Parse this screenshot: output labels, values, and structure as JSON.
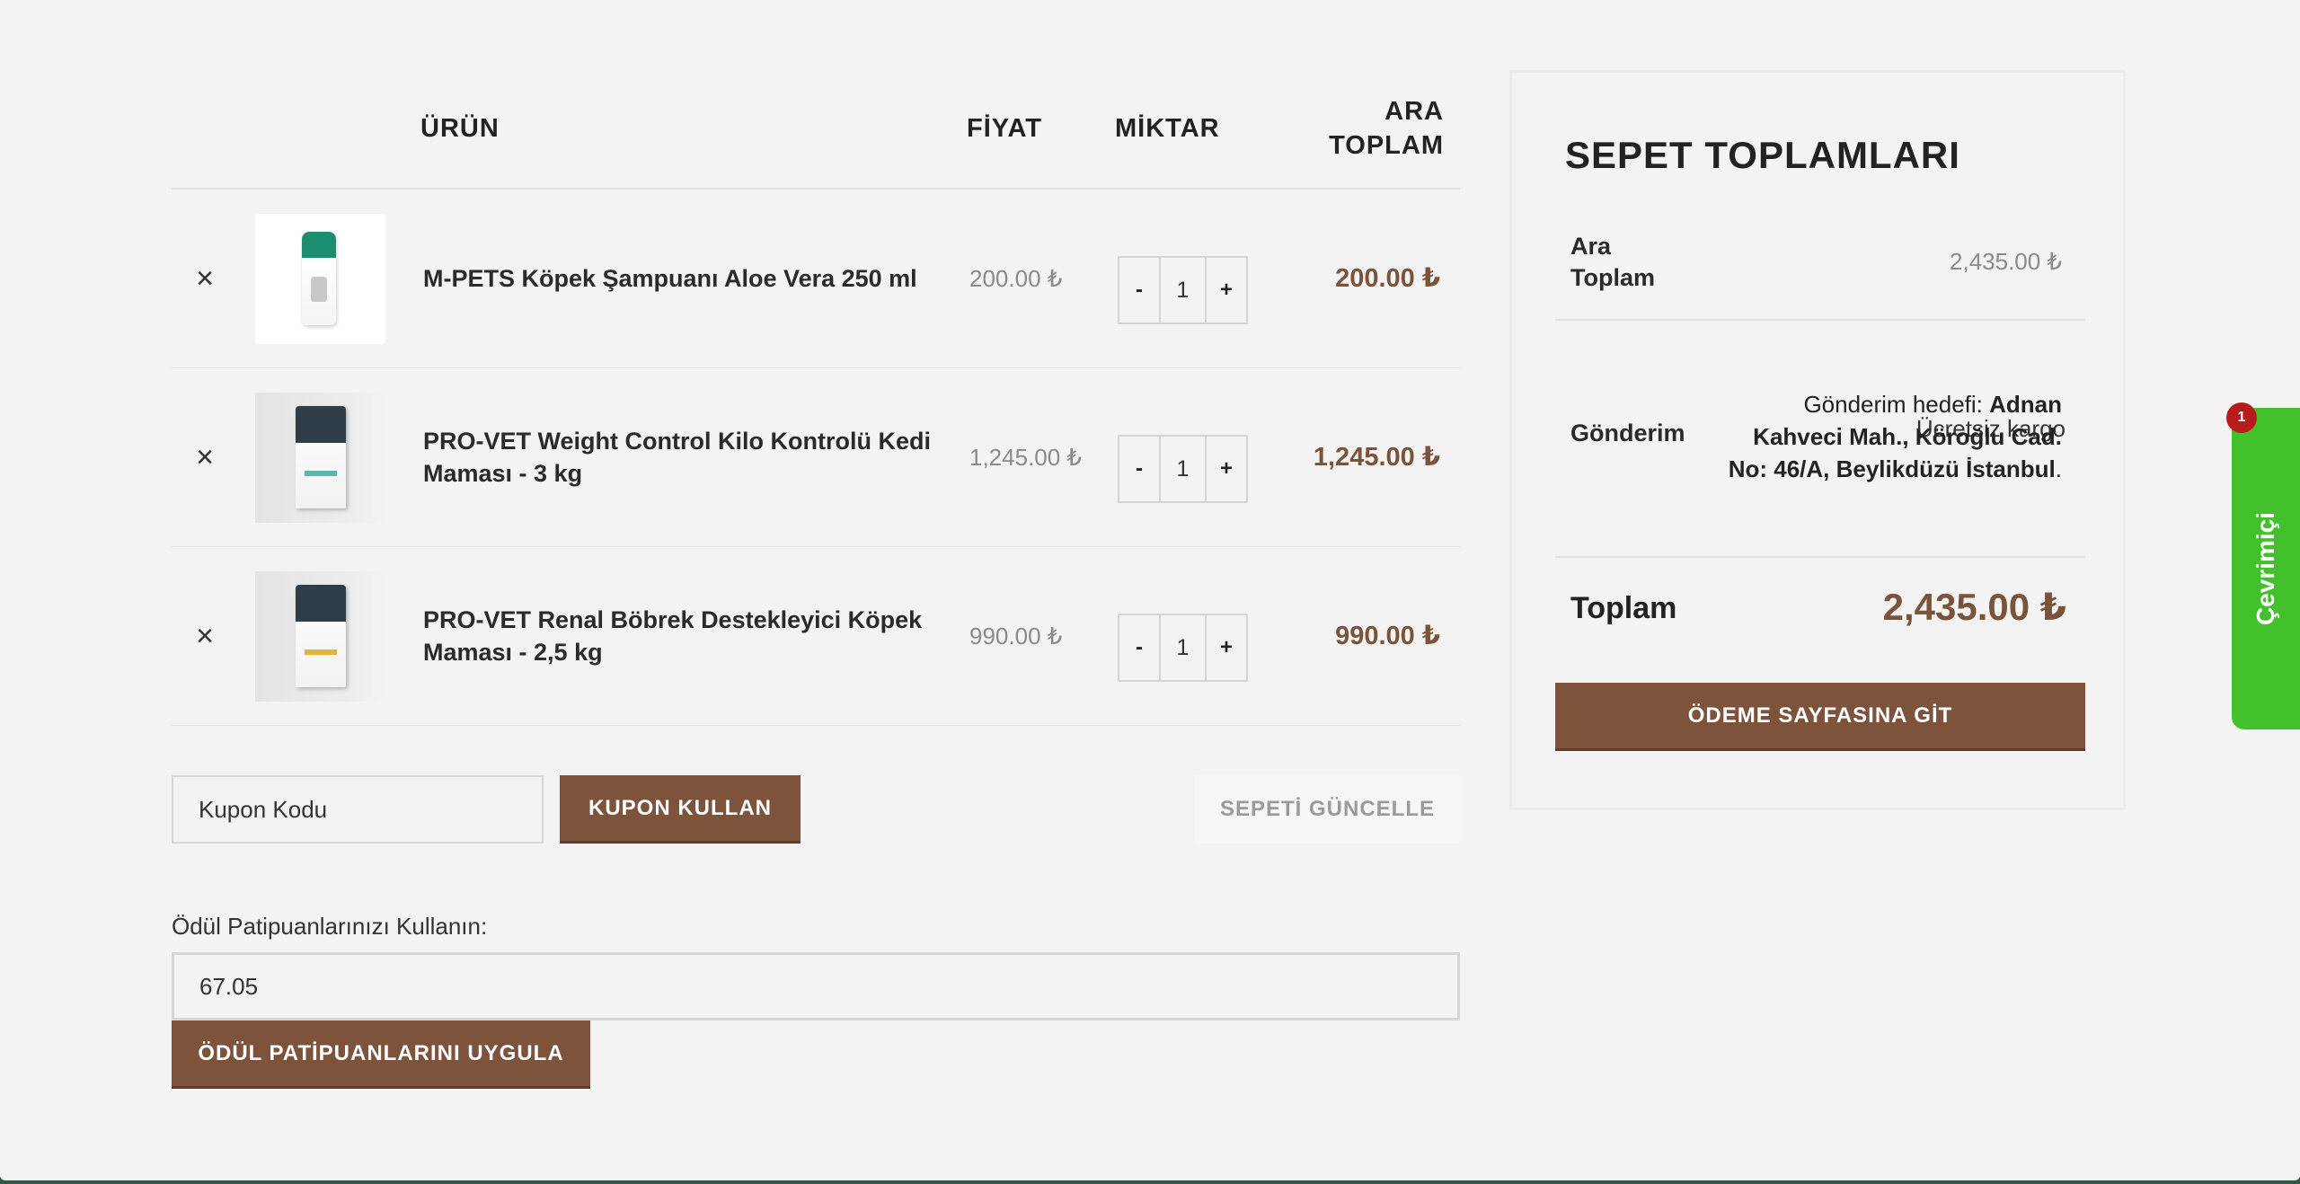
{
  "cart": {
    "headers": {
      "product": "ÜRÜN",
      "price": "FİYAT",
      "quantity": "MİKTAR",
      "subtotal_line1": "ARA",
      "subtotal_line2": "TOPLAM"
    },
    "items": [
      {
        "name": "M-PETS Köpek Şampuanı Aloe Vera 250 ml",
        "price": "200.00 ₺",
        "quantity": "1",
        "subtotal": "200.00 ₺",
        "image_icon": "shampoo-bottle-icon"
      },
      {
        "name": "PRO-VET Weight Control Kilo Kontrolü Kedi Maması - 3 kg",
        "price": "1,245.00 ₺",
        "quantity": "1",
        "subtotal": "1,245.00 ₺",
        "image_icon": "food-bag-icon"
      },
      {
        "name": "PRO-VET Renal Böbrek Destekleyici Köpek Maması - 2,5 kg",
        "price": "990.00 ₺",
        "quantity": "1",
        "subtotal": "990.00 ₺",
        "image_icon": "food-bag-icon"
      }
    ],
    "remove_symbol": "×",
    "minus": "-",
    "plus": "+"
  },
  "coupon": {
    "placeholder": "Kupon Kodu",
    "apply_label": "KUPON KULLAN",
    "update_label": "SEPETİ GÜNCELLE"
  },
  "points": {
    "label": "Ödül Patipuanlarınızı Kullanın:",
    "value": "67.05",
    "apply_label": "ÖDÜL PATİPUANLARINI UYGULA"
  },
  "totals": {
    "title": "SEPET TOPLAMLARI",
    "subtotal_label_line1": "Ara",
    "subtotal_label_line2": "Toplam",
    "subtotal_value": "2,435.00 ₺",
    "shipping_label": "Gönderim",
    "shipping_free": "Ücretsiz kargo",
    "shipping_dest_prefix": "Gönderim hedefi: ",
    "shipping_address": "Adnan Kahveci Mah., Köroğlu Cad. No: 46/A, Beylikdüzü İstanbul",
    "shipping_dest_suffix": ".",
    "total_label": "Toplam",
    "total_value": "2,435.00 ₺",
    "checkout_label": "ÖDEME SAYFASINA GİT"
  },
  "online_widget": {
    "label": "Çevrimiçi",
    "badge_count": "1"
  },
  "colors": {
    "brand_brown": "#7d543b",
    "price_brown": "#7b533b",
    "online_green": "#43c12b",
    "badge_red": "#b81b1b"
  }
}
